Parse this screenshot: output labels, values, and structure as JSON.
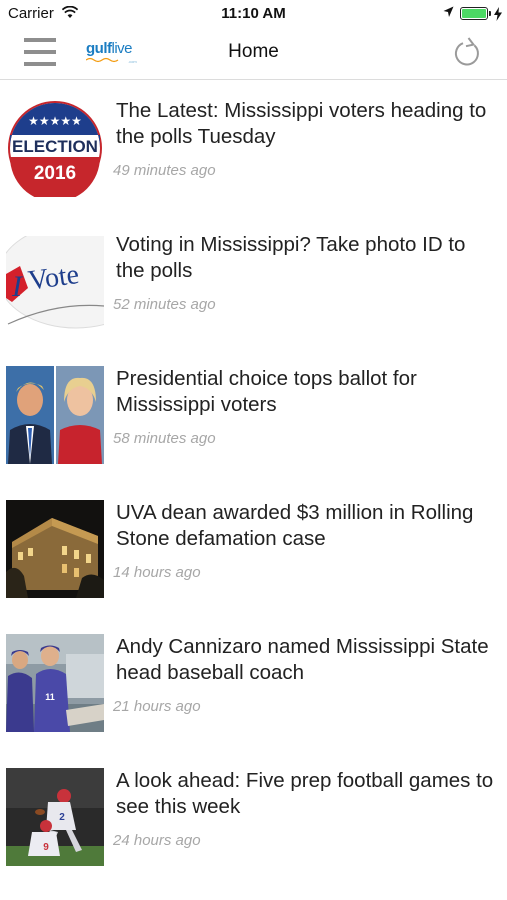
{
  "status_bar": {
    "carrier": "Carrier",
    "time": "11:10 AM"
  },
  "nav": {
    "title": "Home",
    "logo": {
      "brand": "gulf",
      "brand_suffix": "live",
      "sub": ".com"
    }
  },
  "colors": {
    "accent": "#1b7dc2",
    "timestamp": "#a7a7a7",
    "battery": "#4cd964"
  },
  "articles": [
    {
      "headline": "The Latest: Mississippi voters heading to the polls Tuesday",
      "time": "49 minutes ago",
      "thumb": "election-2016-badge",
      "thumb_text": {
        "top": "ELECTION",
        "year": "2016"
      }
    },
    {
      "headline": "Voting in Mississippi? Take photo ID to the polls",
      "time": "52 minutes ago",
      "thumb": "i-vote-sticker",
      "thumb_text": {
        "i": "I",
        "vote": "Vote"
      }
    },
    {
      "headline": "Presidential choice tops ballot for Mississippi voters",
      "time": "58 minutes ago",
      "thumb": "candidates-portraits"
    },
    {
      "headline": "UVA dean awarded $3 million in Rolling Stone defamation case",
      "time": "14 hours ago",
      "thumb": "campus-building-night"
    },
    {
      "headline": "Andy Cannizaro named Mississippi State head baseball coach",
      "time": "21 hours ago",
      "thumb": "baseball-dugout"
    },
    {
      "headline": "A look ahead: Five prep football games to see this week",
      "time": "24 hours ago",
      "thumb": "football-game-action"
    }
  ]
}
